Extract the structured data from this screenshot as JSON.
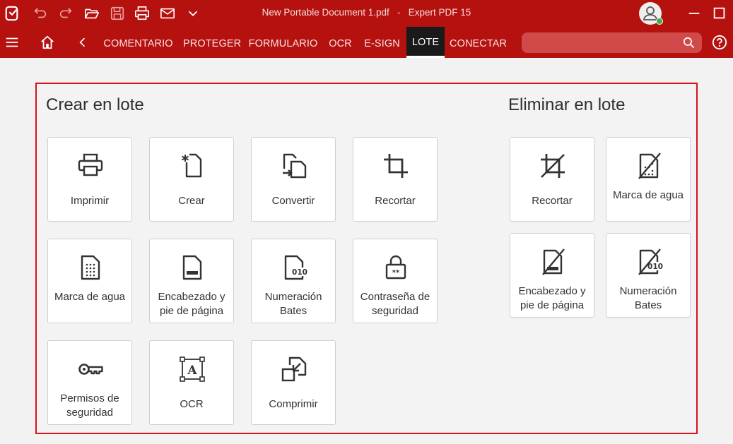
{
  "window": {
    "document_title": "New Portable Document 1.pdf   -   Expert PDF 15"
  },
  "toolbar": {
    "icons": [
      "app-logo-icon",
      "undo-icon",
      "redo-icon",
      "open-folder-icon",
      "save-icon",
      "print-icon",
      "email-icon",
      "chevron-down-icon",
      "user-account-icon",
      "minimize-icon",
      "maximize-icon"
    ]
  },
  "tabs": [
    {
      "label": "COMENTARIO",
      "active": false
    },
    {
      "label": "PROTEGER",
      "active": false
    },
    {
      "label": "FORMULARIO",
      "active": false
    },
    {
      "label": "OCR",
      "active": false
    },
    {
      "label": "E-SIGN",
      "active": false
    },
    {
      "label": "LOTE",
      "active": true
    },
    {
      "label": "CONECTAR",
      "active": false
    }
  ],
  "search": {
    "placeholder": ""
  },
  "colors": {
    "brand_red": "#b5110f",
    "active_tab": "#1a1a1a",
    "highlight_border": "#d7141a",
    "status_online": "#3cb043"
  },
  "create_section": {
    "title": "Crear en lote",
    "tiles": [
      {
        "label": "Imprimir",
        "icon": "printer-icon"
      },
      {
        "label": "Crear",
        "icon": "new-document-icon"
      },
      {
        "label": "Convertir",
        "icon": "convert-icon"
      },
      {
        "label": "Recortar",
        "icon": "crop-icon"
      },
      {
        "label": "Marca de agua",
        "icon": "watermark-icon"
      },
      {
        "label": "Encabezado y pie de página",
        "icon": "header-footer-icon"
      },
      {
        "label": "Numeración Bates",
        "icon": "bates-numbering-icon"
      },
      {
        "label": "Contraseña de seguridad",
        "icon": "password-lock-icon"
      },
      {
        "label": "Permisos de seguridad",
        "icon": "key-icon"
      },
      {
        "label": "OCR",
        "icon": "ocr-icon"
      },
      {
        "label": "Comprimir",
        "icon": "compress-icon"
      }
    ]
  },
  "remove_section": {
    "title": "Eliminar en lote",
    "tiles": [
      {
        "label": "Recortar",
        "icon": "remove-crop-icon"
      },
      {
        "label": "Marca de agua",
        "icon": "remove-watermark-icon"
      },
      {
        "label": "Encabezado y pie de página",
        "icon": "remove-header-footer-icon"
      },
      {
        "label": "Numeración Bates",
        "icon": "remove-bates-icon"
      }
    ]
  }
}
